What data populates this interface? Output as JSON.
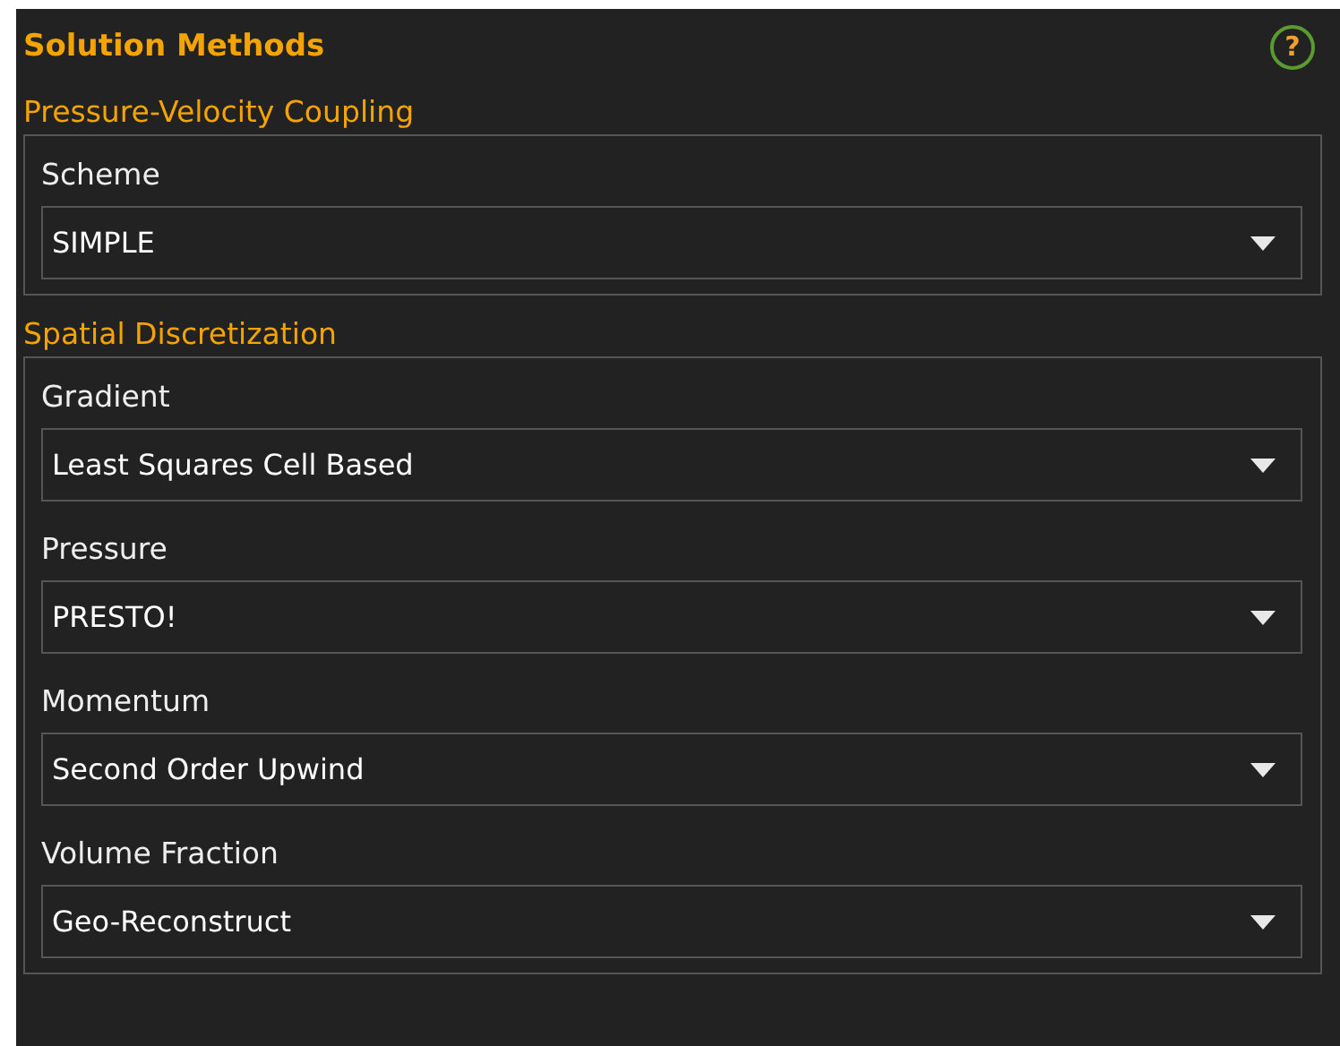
{
  "panel": {
    "title": "Solution Methods",
    "help_glyph": "?"
  },
  "sections": [
    {
      "title": "Pressure-Velocity Coupling",
      "fields": [
        {
          "label": "Scheme",
          "value": "SIMPLE"
        }
      ]
    },
    {
      "title": "Spatial Discretization",
      "fields": [
        {
          "label": "Gradient",
          "value": "Least Squares Cell Based"
        },
        {
          "label": "Pressure",
          "value": "PRESTO!"
        },
        {
          "label": "Momentum",
          "value": "Second Order Upwind"
        },
        {
          "label": "Volume Fraction",
          "value": "Geo-Reconstruct"
        }
      ]
    }
  ]
}
